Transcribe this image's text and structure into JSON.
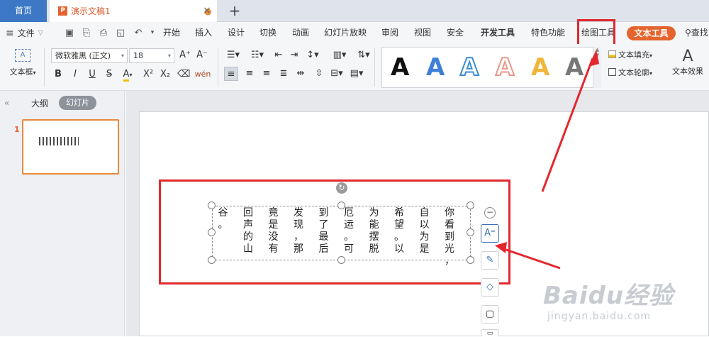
{
  "tabs": {
    "home": "首页",
    "doc_title": "演示文稿1",
    "doc_dot": "●",
    "close": "×",
    "new_tab": "+"
  },
  "menubar": {
    "file": "文件",
    "items": [
      "开始",
      "插入",
      "设计",
      "切换",
      "动画",
      "幻灯片放映",
      "审阅",
      "视图",
      "安全",
      "开发工具",
      "特色功能",
      "绘图工具"
    ],
    "text_tool": "文本工具",
    "search": "查找"
  },
  "ribbon": {
    "textbox_label": "文本框",
    "font_name": "微软雅黑 (正文)",
    "font_size": "18",
    "wordart_samples": [
      "A",
      "A",
      "A",
      "A",
      "A",
      "A"
    ],
    "text_fill": "文本填充",
    "text_outline": "文本轮廓",
    "text_effect": "文本效果",
    "effect_glyph": "A"
  },
  "leftpanel": {
    "outline_tab": "大纲",
    "slides_tab": "幻灯片",
    "slide_number": "1"
  },
  "slide_text_columns": [
    "你看到光，",
    "自以为是",
    "希望。以",
    "为能摆脱",
    "厄运。可",
    "到了最后",
    "发现，那",
    "竟是没有",
    "回声的山",
    "谷。"
  ],
  "watermark": {
    "brand": "Baidu经验",
    "url": "jingyan.baidu.com"
  },
  "colors": {
    "accent_orange": "#e4642d",
    "highlight_red": "#e2282e",
    "home_tab_blue": "#3d78c6"
  }
}
